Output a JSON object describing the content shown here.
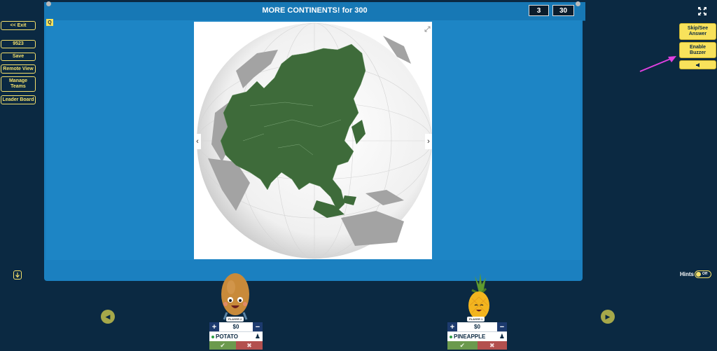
{
  "header": {
    "title": "MORE CONTINENTS! for 300",
    "score_left": "3",
    "score_right": "30"
  },
  "left_menu": {
    "exit": "<< Exit",
    "game_code": "9523",
    "save": "Save",
    "remote_view": "Remote View",
    "manage_teams": "Manage Teams",
    "leader_board": "Leader Board"
  },
  "right_menu": {
    "skip": "Skip/See Answer",
    "buzzer": "Enable Buzzer",
    "sound_icon": "speaker-icon"
  },
  "question": {
    "badge": "Q"
  },
  "hints": {
    "label": "Hints",
    "toggle": "Off"
  },
  "players": [
    {
      "badge": "PLAYER 2",
      "money": "$0",
      "name": "POTATO"
    },
    {
      "badge": "PLAYER 1",
      "money": "$0",
      "name": "PINEAPPLE"
    }
  ],
  "colors": {
    "background": "#0b2942",
    "panel": "#1b80c0",
    "button": "#f8e25b",
    "annotation_arrow": "#e040e0"
  }
}
